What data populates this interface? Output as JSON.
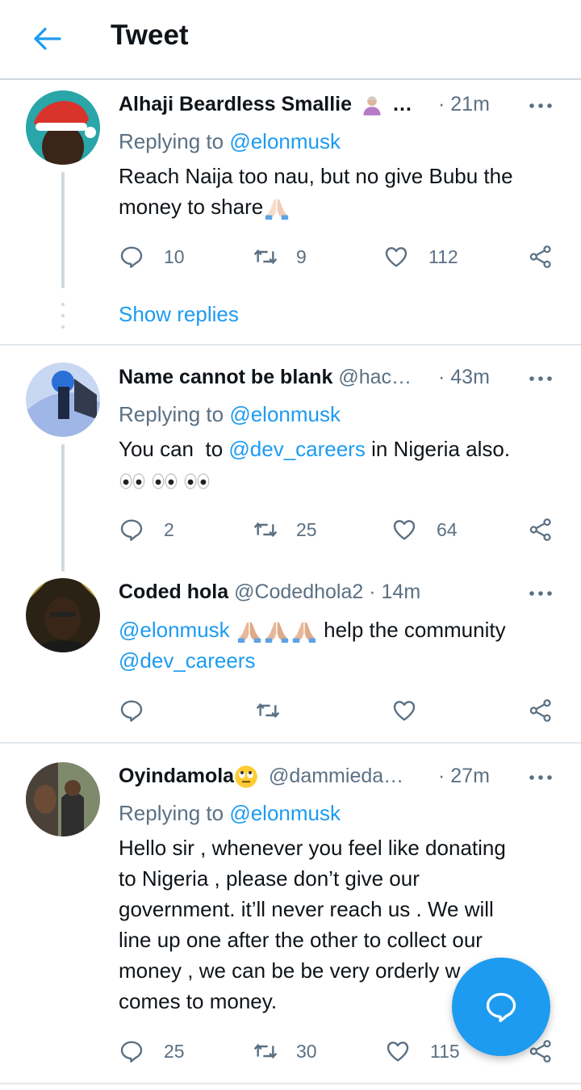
{
  "header": {
    "title": "Tweet"
  },
  "tweets": [
    {
      "name": "Alhaji Beardless Smallie",
      "handle": "…",
      "time": "· 21m",
      "reply_prefix": "Replying to",
      "reply_handle": "@elonmusk",
      "text_lines": [
        "Reach Naija too nau, but no give Bubu the",
        "money to share"
      ],
      "replies": "10",
      "retweets": "9",
      "likes": "112",
      "show_replies": "Show replies"
    },
    {
      "name": "Name cannot be blank",
      "handle": "@hac…",
      "time": "· 43m",
      "reply_prefix": "Replying to",
      "reply_handle": "@elonmusk",
      "text_a": "You can  to ",
      "text_mention": "@dev_careers",
      "text_b": " in Nigeria also.",
      "replies": "2",
      "retweets": "25",
      "likes": "64"
    },
    {
      "name": "Coded hola",
      "handle": "@Codedhola2",
      "time": "· 14m",
      "mention1": "@elonmusk",
      "text_a": " help the community",
      "mention2": "@dev_careers"
    },
    {
      "name": "Oyindamola",
      "handle": "@dammieda…",
      "time": "· 27m",
      "reply_prefix": "Replying to",
      "reply_handle": "@elonmusk",
      "text_lines": [
        "Hello sir , whenever you feel like donating",
        "to Nigeria , please don’t give our",
        "government. it’ll never reach us . We will",
        "line up one after the other to collect our",
        "money , we can be be very orderly w",
        "comes to money."
      ],
      "replies": "25",
      "retweets": "30",
      "likes": "115"
    }
  ],
  "colors": {
    "accent": "#1d9bf0",
    "muted": "#5b7083",
    "text": "#0f1419",
    "divider": "#e1e8ed"
  }
}
